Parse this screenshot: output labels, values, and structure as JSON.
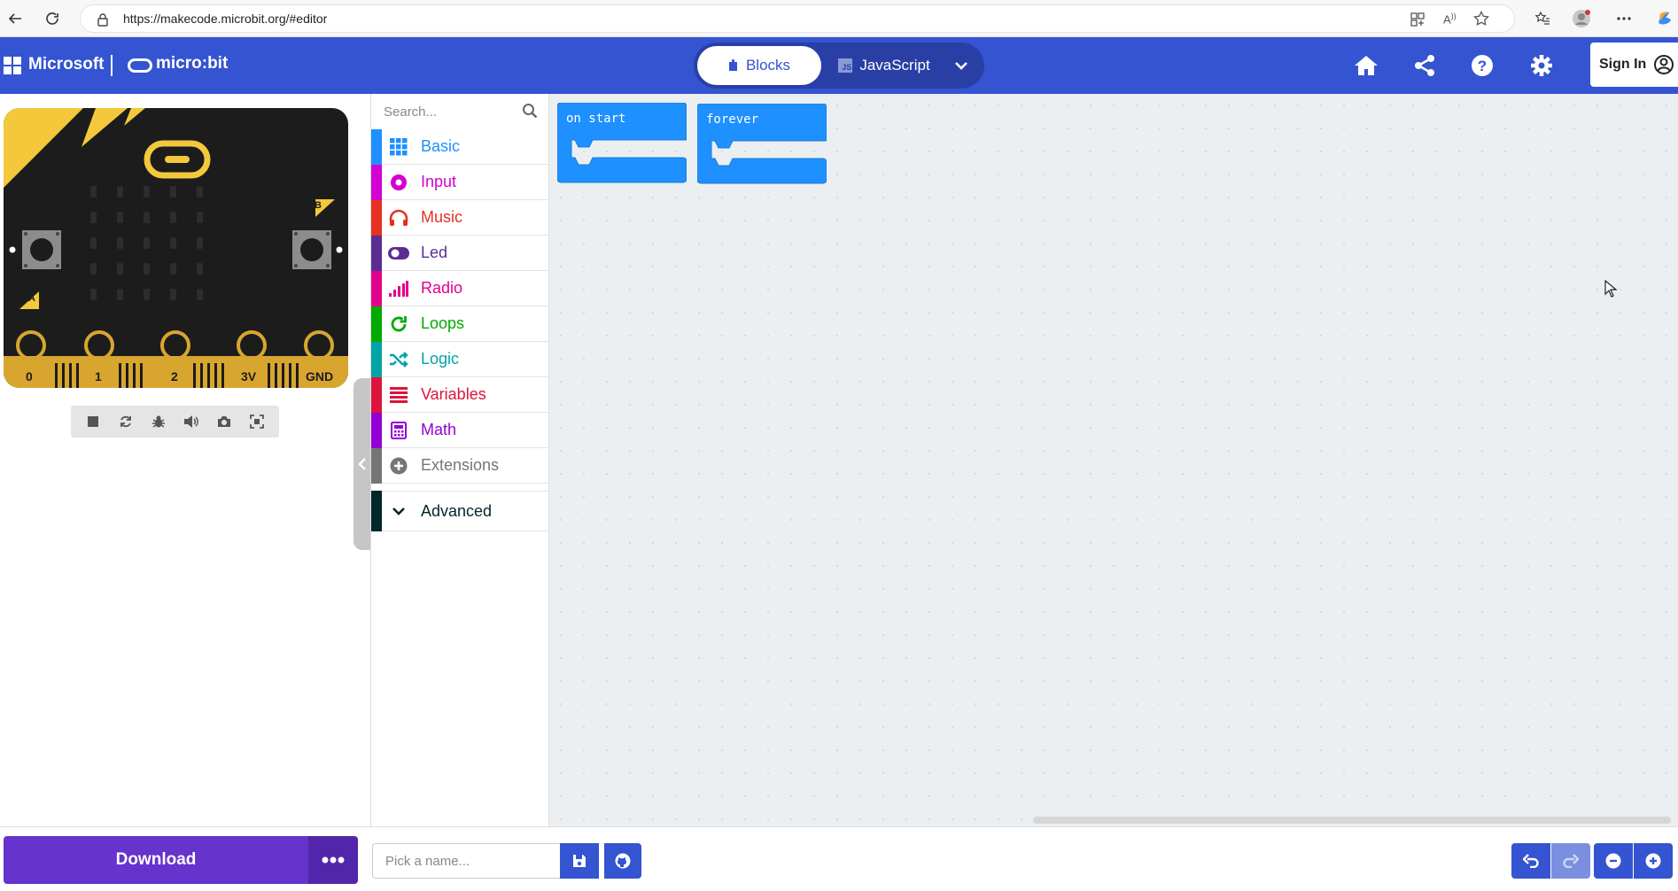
{
  "browser": {
    "url": "https://makecode.microbit.org/#editor"
  },
  "header": {
    "microsoft_label": "Microsoft",
    "product_label": "micro:bit",
    "tabs": [
      {
        "label": "Blocks",
        "active": true
      },
      {
        "label": "JavaScript",
        "active": false
      }
    ],
    "js_badge": "JS",
    "signin_label": "Sign In"
  },
  "simulator": {
    "pins": [
      "0",
      "1",
      "2",
      "3V",
      "GND"
    ],
    "button_a_label": "A",
    "button_b_label": "B"
  },
  "toolbox": {
    "search_placeholder": "Search...",
    "categories": [
      {
        "label": "Basic",
        "color": "#1e90ff"
      },
      {
        "label": "Input",
        "color": "#d400d4"
      },
      {
        "label": "Music",
        "color": "#e63022"
      },
      {
        "label": "Led",
        "color": "#5c2d91"
      },
      {
        "label": "Radio",
        "color": "#e3008c"
      },
      {
        "label": "Loops",
        "color": "#00aa00"
      },
      {
        "label": "Logic",
        "color": "#00a4a6"
      },
      {
        "label": "Variables",
        "color": "#dc143c"
      },
      {
        "label": "Math",
        "color": "#9400d3"
      },
      {
        "label": "Extensions",
        "color": "#757575"
      }
    ],
    "advanced_label": "Advanced",
    "advanced_color": "#00272b"
  },
  "workspace": {
    "blocks": [
      {
        "label": "on start"
      },
      {
        "label": "forever"
      }
    ],
    "block_color": "#1e90ff"
  },
  "bottombar": {
    "download_label": "Download",
    "name_placeholder": "Pick a name..."
  }
}
